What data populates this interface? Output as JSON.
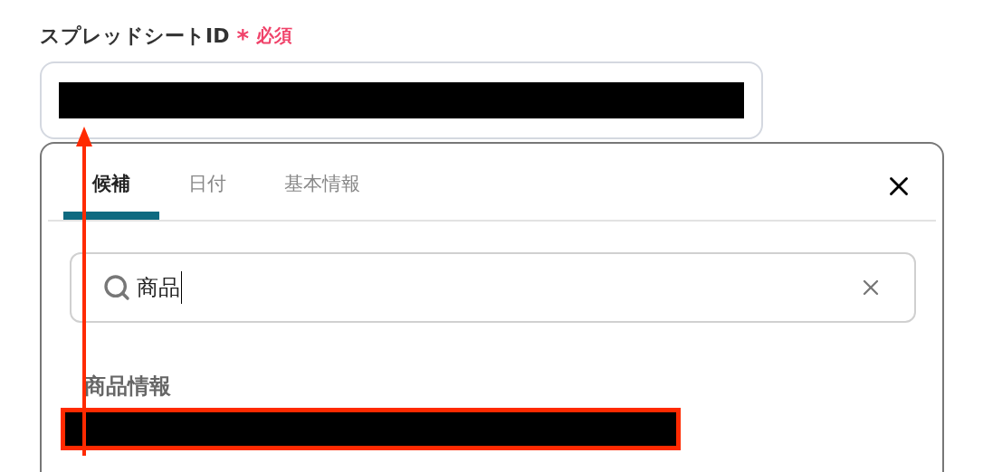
{
  "field": {
    "label": "スプレッドシートID",
    "required_mark": "*",
    "required": "必須"
  },
  "tabs": [
    {
      "label": "候補",
      "selected": true
    },
    {
      "label": "日付",
      "selected": false
    },
    {
      "label": "基本情報",
      "selected": false
    }
  ],
  "search": {
    "value": "商品"
  },
  "groups": [
    {
      "title": "商品情報"
    }
  ]
}
